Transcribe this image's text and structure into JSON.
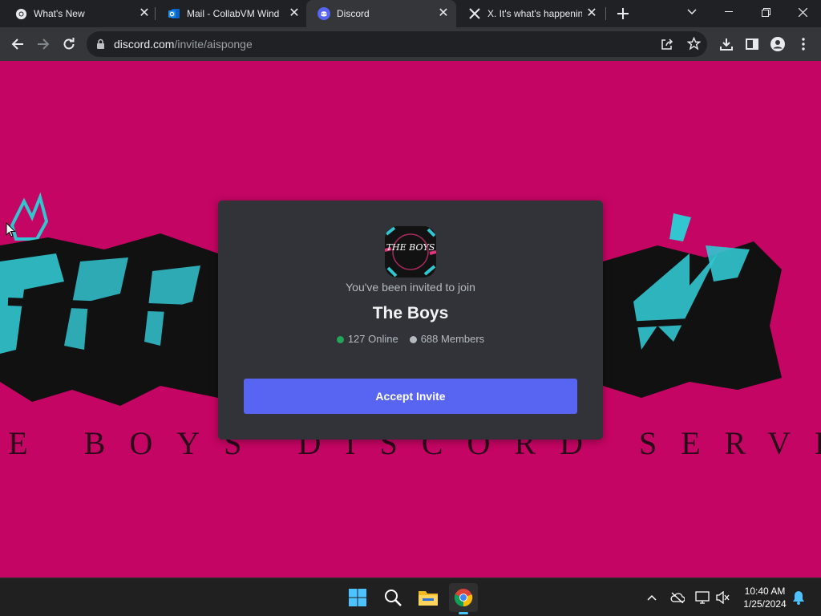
{
  "tabs": [
    {
      "title": "What's New",
      "icon": "chrome-icon"
    },
    {
      "title": "Mail - CollabVM Wind",
      "icon": "outlook-icon"
    },
    {
      "title": "Discord",
      "icon": "discord-icon",
      "active": true
    },
    {
      "title": "X. It's what's happenin",
      "icon": "x-icon"
    }
  ],
  "address_bar": {
    "domain": "discord.com",
    "path": "/invite/aisponge"
  },
  "banner": {
    "text": "THE BOYS DISCORD SERVER"
  },
  "invite": {
    "server_icon_text": "THE BOYS",
    "prompt": "You've been invited to join",
    "server_name": "The Boys",
    "online": "127 Online",
    "members": "688 Members",
    "accept_label": "Accept Invite"
  },
  "colors": {
    "banner_bg": "#c40563",
    "accent": "#5865f2",
    "online": "#23a55a",
    "members": "#b5bac1"
  },
  "taskbar": {
    "time": "10:40 AM",
    "date": "1/25/2024"
  }
}
